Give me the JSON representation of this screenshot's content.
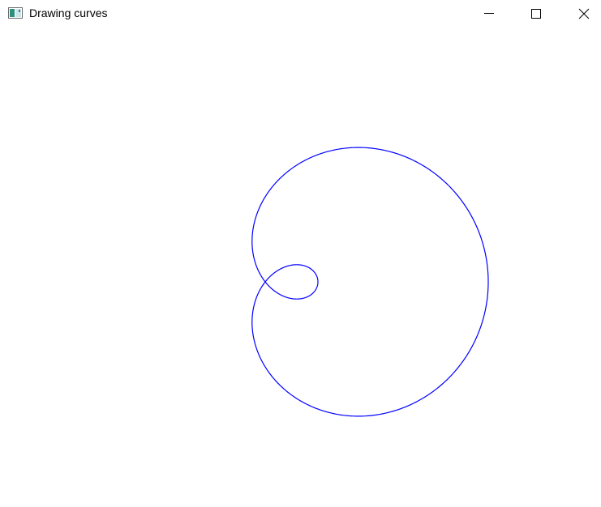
{
  "window": {
    "title": "Drawing curves"
  },
  "icons": {
    "app": "app-window-icon",
    "minimize": "minimize-icon",
    "maximize": "maximize-icon",
    "close": "close-icon"
  },
  "curve": {
    "name": "limacon",
    "stroke_color": "#0000ff",
    "background_color": "#ffffff"
  }
}
